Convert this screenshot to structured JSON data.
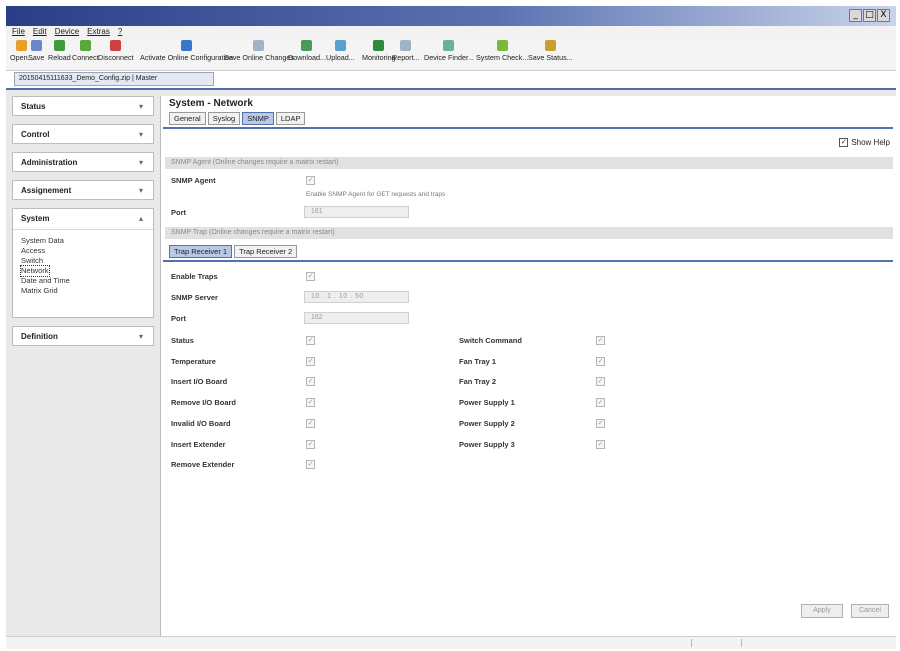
{
  "window": {
    "controls": [
      "_",
      "□",
      "X"
    ]
  },
  "menu": [
    "File",
    "Edit",
    "Device",
    "Extras",
    "?"
  ],
  "toolbar": [
    {
      "label": "Open...",
      "icon": "folder-open-icon",
      "color": "#e6a129"
    },
    {
      "label": "Save",
      "icon": "save-icon",
      "color": "#6a86c4"
    },
    {
      "label": "Reload",
      "icon": "reload-icon",
      "color": "#3f9a3a"
    },
    {
      "label": "Connect",
      "icon": "connect-plug-icon",
      "color": "#5aa83a"
    },
    {
      "label": "Disconnect",
      "icon": "disconnect-plug-icon",
      "color": "#d04040"
    },
    {
      "label": "Activate Online Configuration",
      "icon": "activate-icon",
      "color": "#3a76c8"
    },
    {
      "label": "Save Online Changes",
      "icon": "save-online-icon",
      "color": "#9fb3c8"
    },
    {
      "label": "Download...",
      "icon": "download-icon",
      "color": "#4a9a58"
    },
    {
      "label": "Upload...",
      "icon": "upload-icon",
      "color": "#5aa0cc"
    },
    {
      "label": "Monitoring",
      "icon": "monitoring-icon",
      "color": "#2f8a3a"
    },
    {
      "label": "Report...",
      "icon": "report-icon",
      "color": "#9fb3c8"
    },
    {
      "label": "Device Finder...",
      "icon": "device-finder-icon",
      "color": "#6ab0a0"
    },
    {
      "label": "System Check...",
      "icon": "system-check-icon",
      "color": "#7ab83a"
    },
    {
      "label": "Save Status...",
      "icon": "save-status-icon",
      "color": "#c8a030"
    }
  ],
  "file_tab": "20150415111633_Demo_Config.zip | Master",
  "sidebar": [
    {
      "label": "Status",
      "chevron": "▾"
    },
    {
      "label": "Control",
      "chevron": "▾"
    },
    {
      "label": "Administration",
      "chevron": "▾"
    },
    {
      "label": "Assignement",
      "chevron": "▾"
    },
    {
      "label": "System",
      "chevron": "▴",
      "links": [
        "System Data",
        "Access",
        "Switch",
        "Network",
        "Date and Time",
        "Matrix Grid"
      ],
      "selected": 3
    },
    {
      "label": "Definition",
      "chevron": "▾"
    }
  ],
  "page": {
    "title": "System - Network",
    "tabs": [
      "General",
      "Syslog",
      "SNMP",
      "LDAP"
    ],
    "active_tab": 2,
    "show_help": "Show Help",
    "agent_section": "SNMP Agent (Online changes require a matrix restart)",
    "agent_label": "SNMP Agent",
    "agent_hint": "Enable SNMP Agent for GET requests and traps",
    "port_label": "Port",
    "agent_port": "161",
    "trap_section": "SNMP Trap (Online changes require a matrix restart)",
    "trap_tabs": [
      "Trap Receiver 1",
      "Trap Receiver 2"
    ],
    "enable_traps": "Enable Traps",
    "server_label": "SNMP Server",
    "server_ip": [
      "10",
      "1",
      "10",
      "50"
    ],
    "trap_port": "162",
    "left_traps": [
      "Status",
      "Temperature",
      "Insert I/O Board",
      "Remove I/O Board",
      "Invalid I/O Board",
      "Insert Extender",
      "Remove Extender"
    ],
    "right_traps": [
      "Switch Command",
      "Fan Tray 1",
      "Fan Tray 2",
      "Power Supply 1",
      "Power Supply 2",
      "Power Supply 3"
    ],
    "apply": "Apply",
    "cancel": "Cancel"
  }
}
